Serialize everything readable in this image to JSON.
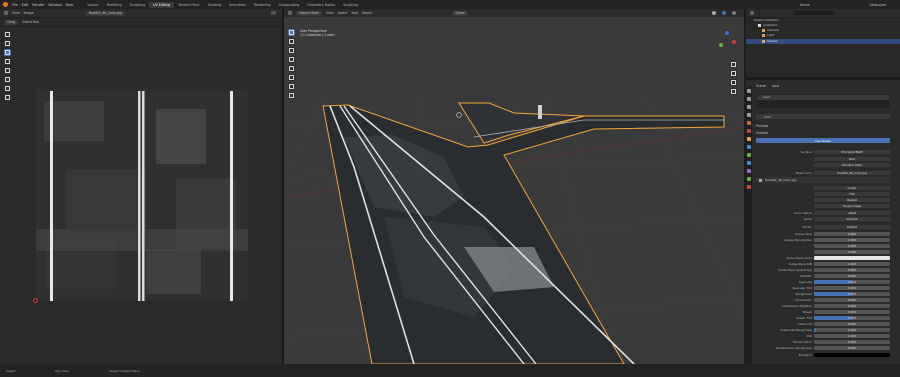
{
  "app": {
    "menu": [
      "File",
      "Edit",
      "Render",
      "Window",
      "Help"
    ],
    "workspaces": [
      "Layout",
      "Modeling",
      "Sculpting",
      "UV Editing",
      "Texture Paint",
      "Shading",
      "Animation",
      "Rendering",
      "Compositing",
      "Geometry Nodes",
      "Scripting"
    ],
    "active_workspace": "UV Editing",
    "scene": "Scene",
    "view_layer": "ViewLayer"
  },
  "uv_editor": {
    "header": {
      "mode": "UV Editor",
      "menus": [
        "View",
        "Image"
      ],
      "image_name": "Road02_4K_Color.jpg"
    },
    "subheader": {
      "sync": "Chug",
      "select_box": "Select Box"
    }
  },
  "viewport": {
    "header": {
      "mode": "Object Mode",
      "menus": [
        "View",
        "Select",
        "Add",
        "Object"
      ],
      "orientation": "Global"
    },
    "overlay_text": {
      "view": "User Perspective",
      "collection": "(1) Collection | Cuvan"
    }
  },
  "outliner": {
    "title": "Scene Collection",
    "rows": [
      {
        "label": "Scene Collection",
        "selected": false
      },
      {
        "label": "Collection",
        "selected": false
      },
      {
        "label": "Camera",
        "selected": false
      },
      {
        "label": "Light",
        "selected": false
      },
      {
        "label": "Curvan",
        "selected": true
      }
    ]
  },
  "properties": {
    "breadcrumb": [
      "Scene",
      "road"
    ],
    "material_slot": "road",
    "material_name": "road",
    "preview_label": "Preview",
    "surface_label": "Surface",
    "use_nodes": "Use Nodes",
    "surface_row": {
      "label": "Surface",
      "value": "Principled BSDF"
    },
    "ggx_value": "GGX",
    "random_walk_value": "Random Walk",
    "base_color": {
      "label": "Base Color",
      "value": "Road02_4K_Color.jpg"
    },
    "image_settings": [
      "Linear",
      "Flat",
      "Repeat",
      "Single Image"
    ],
    "color_space": {
      "label": "Color Space",
      "value": "sRGB"
    },
    "alpha": {
      "label": "Alpha",
      "value": "Straight"
    },
    "vector": {
      "label": "Vector",
      "value": "Default"
    },
    "props": [
      {
        "label": "Subsurface",
        "value": "0.000",
        "fill": 0
      },
      {
        "label": "Subsurface Radius",
        "value": "1.000",
        "fill": 0
      },
      {
        "label": "",
        "value": "0.200",
        "fill": 0
      },
      {
        "label": "",
        "value": "0.100",
        "fill": 0
      },
      {
        "label": "Subsurface Color",
        "value": "",
        "fill": 0,
        "swatch": "#e6e6e6"
      },
      {
        "label": "Subsurface IOR",
        "value": "1.400",
        "fill": 0
      },
      {
        "label": "Subsurface Anisotropy",
        "value": "0.000",
        "fill": 0
      },
      {
        "label": "Metallic",
        "value": "0.000",
        "fill": 0
      },
      {
        "label": "Specular",
        "value": "0.500",
        "fill": 0.5
      },
      {
        "label": "Specular Tint",
        "value": "0.000",
        "fill": 0
      },
      {
        "label": "Roughness",
        "value": "0.500",
        "fill": 0.5
      },
      {
        "label": "Anisotropic",
        "value": "0.000",
        "fill": 0
      },
      {
        "label": "Anisotropic Rotation",
        "value": "0.000",
        "fill": 0
      },
      {
        "label": "Sheen",
        "value": "0.000",
        "fill": 0
      },
      {
        "label": "Sheen Tint",
        "value": "0.500",
        "fill": 0.5
      },
      {
        "label": "Clearcoat",
        "value": "0.000",
        "fill": 0
      },
      {
        "label": "Clearcoat Roughness",
        "value": "0.030",
        "fill": 0.03
      },
      {
        "label": "IOR",
        "value": "1.450",
        "fill": 0
      },
      {
        "label": "Transmission",
        "value": "0.000",
        "fill": 0
      },
      {
        "label": "Transmission Roughness",
        "value": "0.000",
        "fill": 0
      },
      {
        "label": "Emission",
        "value": "",
        "fill": 0,
        "swatch": "#000000"
      }
    ]
  },
  "status": {
    "items": [
      "Select",
      "Pan View",
      "Object Context Menu"
    ]
  },
  "colors": {
    "accent": "#4772b3",
    "selection_outline": "#f5a33a",
    "background": "#1d1d1d"
  }
}
